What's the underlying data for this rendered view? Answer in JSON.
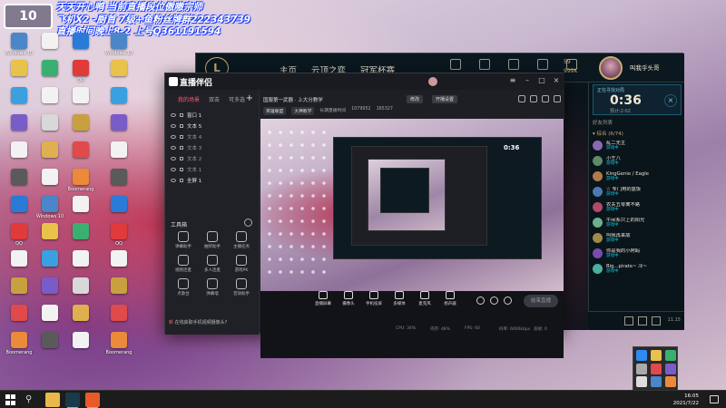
{
  "overlay": {
    "logo": "10",
    "lines": [
      "天天开心鸭  当前直播段位傲嗷宗师",
      "飞机X2 -厨首 7级+鱼粉丝牌群222343739",
      "直播时间晚上8-2  上号Q361191594"
    ]
  },
  "desktop": {
    "icons": [
      {
        "label": "Windows 10",
        "color": "#4a86c8"
      },
      {
        "label": "",
        "color": "#e8c24a"
      },
      {
        "label": "",
        "color": "#3aa0e0"
      },
      {
        "label": "",
        "color": "#7a5cc8"
      },
      {
        "label": "",
        "color": "#f2f2f2"
      },
      {
        "label": "",
        "color": "#5a5a5a"
      },
      {
        "label": "",
        "color": "#2a7ad8"
      },
      {
        "label": "QQ",
        "color": "#e03a3a"
      },
      {
        "label": "",
        "color": "#f2f2f2"
      },
      {
        "label": "",
        "color": "#c8a040"
      },
      {
        "label": "",
        "color": "#e04a4a"
      },
      {
        "label": "Boomerang",
        "color": "#ea8a3a"
      },
      {
        "label": "",
        "color": "#f2f2f2"
      },
      {
        "label": "",
        "color": "#3ab070"
      },
      {
        "label": "",
        "color": "#f2f2f2"
      },
      {
        "label": "",
        "color": "#d8d8d8"
      },
      {
        "label": "",
        "color": "#e0b050"
      },
      {
        "label": "",
        "color": "#f2f2f2"
      }
    ]
  },
  "game": {
    "logo": "L",
    "nav": [
      "主页",
      "云顶之弈",
      "冠军杯赛"
    ],
    "currency": [
      "59",
      "999K"
    ],
    "profile_name": "叫我乎头哥",
    "queue": {
      "label": "正在寻找对局",
      "time": "0:36",
      "sub": "预计:2:02"
    },
    "friends_header": "好友列表",
    "friends_group": "▾ 综合 (6/74)",
    "friends": [
      {
        "name": "乱二无主",
        "status": "游戏中",
        "color": "#8a6ab0"
      },
      {
        "name": "小王八",
        "status": "游戏中",
        "color": "#5d8a6b"
      },
      {
        "name": "KingGenie / Eagle",
        "status": "游戏中",
        "color": "#b07a4a"
      },
      {
        "name": "☆ 专门用的盒饭",
        "status": "游戏中",
        "color": "#4a7ab0"
      },
      {
        "name": "农夫五零离不路",
        "status": "游戏中",
        "color": "#b04a6a"
      },
      {
        "name": "午间系只上的阳光",
        "status": "游戏中",
        "color": "#6ab08a"
      },
      {
        "name": "叫我再来故",
        "status": "游戏中",
        "color": "#a08a4a"
      },
      {
        "name": "你是我的小阿蚂",
        "status": "游戏中",
        "color": "#7a4ab0"
      },
      {
        "name": "Big...pirate~ 冷~",
        "status": "游戏中",
        "color": "#4ab0a0"
      }
    ],
    "version": "11.15"
  },
  "stream_app": {
    "title": "直播伴侣",
    "tabs": [
      "我的场景",
      "双击",
      "可多选"
    ],
    "scenes": [
      {
        "label": "窗口 1",
        "on": true
      },
      {
        "label": "文本 5",
        "on": true
      },
      {
        "label": "文本 4",
        "on": false
      },
      {
        "label": "文本 3",
        "on": false
      },
      {
        "label": "文本 2",
        "on": false
      },
      {
        "label": "文本 1",
        "on": false
      },
      {
        "label": "全屏 1",
        "on": true
      }
    ],
    "toolbox_title": "工具箱",
    "tools": [
      "弹幕助手",
      "抽奖助手",
      "主播任务",
      "视频连麦",
      "多人连麦",
      "游戏PK",
      "点歌台",
      "弹幕墙",
      "音效助手"
    ],
    "hint_new": "新",
    "hint_text": "在线获取手机视频摄像头?",
    "room_title": "国服第一武器 · 上大分教学",
    "room_btn1": "修改",
    "room_btn2": "开播设置",
    "room_tags": [
      "英雄联盟",
      "大神教学",
      "长期直播时间"
    ],
    "room_stats": [
      "1079952",
      "165327"
    ],
    "controls": [
      "直播屏幕",
      "摄像头",
      "手机投屏",
      "多媒体",
      "麦克风",
      "扬声器"
    ],
    "start_btn": "结束直播",
    "status": [
      "CPU: 34%",
      "内存: 48%",
      "FPS: 60",
      "码率: 6000kbps",
      "丢帧: 0"
    ],
    "preview_time": "0:36"
  },
  "taskbar": {
    "time": "16:05",
    "date": "2021/7/22",
    "apps": [
      {
        "name": "file-explorer",
        "color": "#e8b84a",
        "active": false
      },
      {
        "name": "lol-client",
        "color": "#1a3a4a",
        "active": true
      },
      {
        "name": "stream-app",
        "color": "#e85a2a",
        "active": true
      }
    ]
  },
  "tray_popup": {
    "colors": [
      "#2d8cf0",
      "#e8c24a",
      "#3ab070",
      "#aaaaaa",
      "#e04a4a",
      "#7a5cc8",
      "#dddddd",
      "#4a86c8",
      "#ea8a3a"
    ]
  }
}
